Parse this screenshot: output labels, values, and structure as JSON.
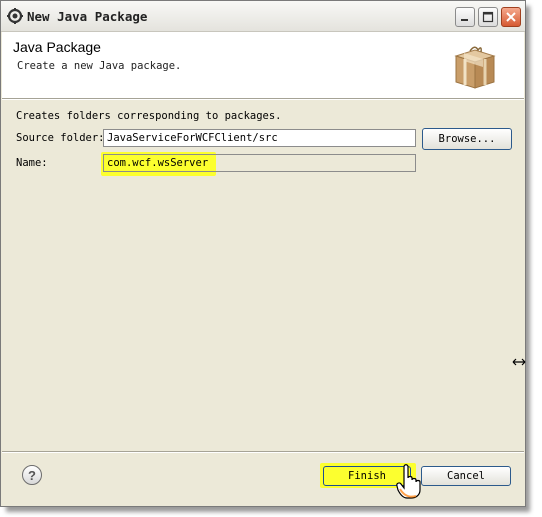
{
  "window": {
    "title": "New Java Package"
  },
  "header": {
    "title": "Java Package",
    "description": "Create a new Java package.",
    "icon": "package-icon"
  },
  "form": {
    "intro": "Creates folders corresponding to packages.",
    "source_folder_label": "Source folder:",
    "source_folder_value": "JavaServiceForWCFClient/src",
    "browse_label": "Browse...",
    "name_label": "Name:",
    "name_value": "com.wcf.wsServer"
  },
  "footer": {
    "finish_label": "Finish",
    "cancel_label": "Cancel"
  },
  "colors": {
    "highlight": "#fcff2f",
    "dialog_bg": "#ece9d8"
  }
}
